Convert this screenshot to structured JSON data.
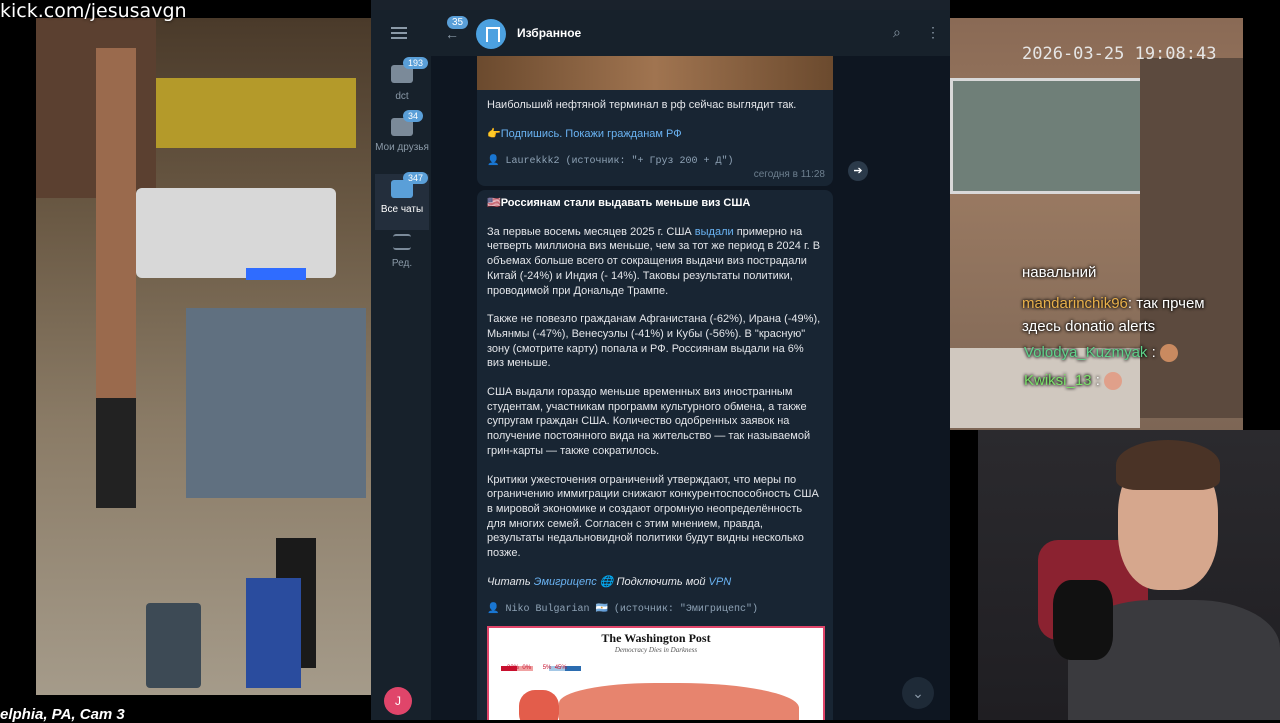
{
  "stream": {
    "url": "kick.com/jesusavgn",
    "cam_label": "elphia, PA, Cam 3",
    "timestamp": "2026-03-25 19:08:43"
  },
  "telegram": {
    "sidebar": [
      {
        "label": "dct",
        "count": "193"
      },
      {
        "label": "Мои друзья",
        "count": "34"
      },
      {
        "label": "Все чаты",
        "count": "347"
      },
      {
        "label": "Ред.",
        "count": ""
      }
    ],
    "header": {
      "back_count": "35",
      "title": "Избранное"
    },
    "msg1": {
      "text": "Наибольший нефтяной терминал в рф сейчас выглядит так.",
      "subscribe": "👉Подпишись. Покажи гражданам РФ",
      "signature": "👤 Laurekkk2 (источник: \"+ Груз 200 + Д\")",
      "time": "сегодня в 11:28"
    },
    "msg2": {
      "title": "🇺🇸Россиянам стали выдавать меньше виз США",
      "p1a": "За первые восемь месяцев 2025 г. США ",
      "p1link": "выдали",
      "p1b": " примерно на четверть миллиона виз меньше, чем за тот же период в 2024 г. В объемах больше всего от сокращения выдачи виз пострадали Китай (-24%) и Индия (- 14%). Таковы результаты политики, проводимой при Дональде Трампе.",
      "p2": "Также не повезло гражданам Афганистана (-62%), Ирана (-49%), Мьянмы (-47%), Венесуэлы (-41%) и Кубы (-56%). В \"красную\" зону (смотрите карту) попала и РФ. Россиянам выдали на 6% виз меньше.",
      "p3": "США выдали гораздо меньше временных виз иностранным студентам, участникам программ культурного обмена, а также супругам граждан США. Количество одобренных заявок на получение постоянного вида на жительство — так называемой грин-карты — также сократилось.",
      "p4": "Критики ужесточения ограничений утверждают, что меры по ограничению иммиграции снижают конкурентоспособность США в мировой экономике и создают огромную неопределённость для многих семей. Согласен с этим мнением, правда, результаты недальновидной политики будут видны несколько позже.",
      "footer_read": "Читать ",
      "footer_src": "Эмигрицепс",
      "footer_mid": " 🌐 Подключить мой ",
      "footer_vpn": "VPN",
      "signature": "👤 Niko Bulgarian 🇦🇷 (источник: \"Эмигрицепс\")",
      "image_title": "The Washington Post",
      "image_subtitle": "Democracy Dies in Darkness",
      "legend": [
        "-33%",
        "0%",
        "5%",
        "45%"
      ]
    },
    "avatar_letter": "J"
  },
  "chat": [
    {
      "user": "",
      "msg": "навальний"
    },
    {
      "user": "mandarinchik96",
      "msg": ": так прчем здесь donatio alerts"
    },
    {
      "user": "Volodya_Kuzmyak",
      "msg": ":"
    },
    {
      "user": "Kwiksi_13",
      "msg": ":"
    }
  ],
  "colors": {
    "tg_bg": "#0e1621",
    "bubble": "#182533",
    "link": "#6ab3f3",
    "user_orange": "#e8b04a",
    "user_green": "#5fd38a"
  }
}
